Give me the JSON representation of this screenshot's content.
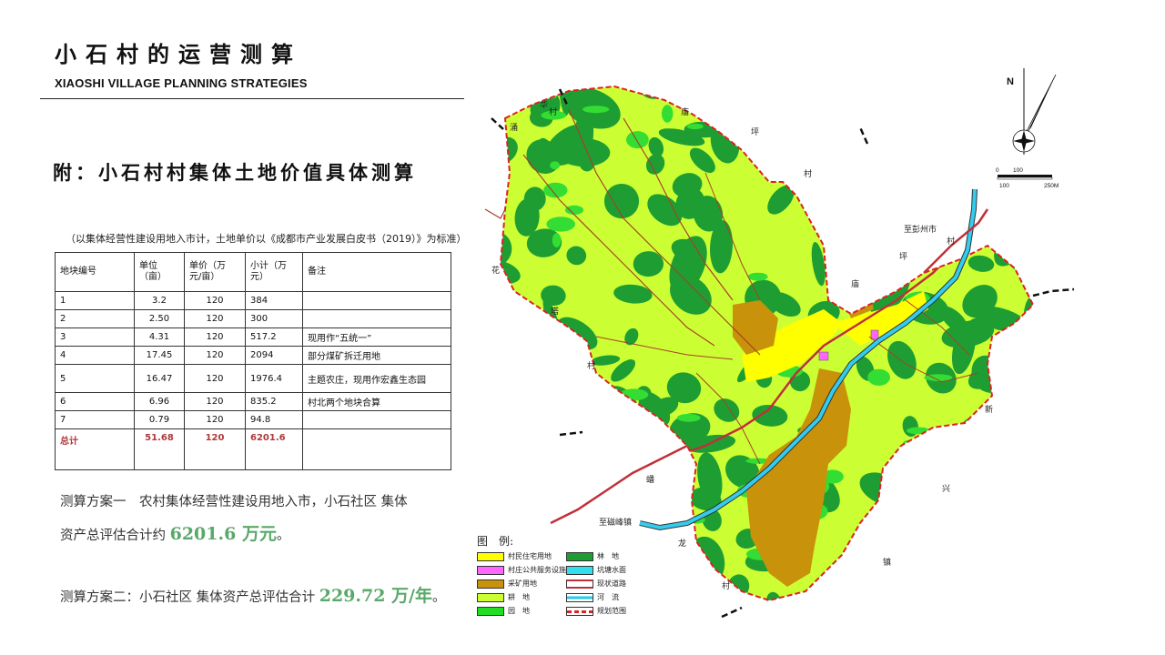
{
  "header": {
    "title_cn": "小石村的运营测算",
    "title_en": "XIAOSHI VILLAGE PLANNING STRATEGIES"
  },
  "section_title": "附：小石村村集体土地价值具体测算",
  "table_note": "（以集体经营性建设用地入市计，土地单价以《成都市产业发展白皮书（2019）》为标准）",
  "table": {
    "headers": [
      "地块编号",
      "单位\n（亩）",
      "单价（万元/亩）",
      "小计（万元）",
      "备注"
    ],
    "rows": [
      [
        "1",
        "3.2",
        "120",
        "384",
        ""
      ],
      [
        "2",
        "2.50",
        "120",
        "300",
        ""
      ],
      [
        "3",
        "4.31",
        "120",
        "517.2",
        "现用作“五统一”"
      ],
      [
        "4",
        "17.45",
        "120",
        "2094",
        "部分煤矿拆迁用地"
      ],
      [
        "5",
        "16.47",
        "120",
        "1976.4",
        "主题农庄，现用作宏鑫生态园"
      ],
      [
        "6",
        "6.96",
        "120",
        "835.2",
        "村北两个地块合算"
      ],
      [
        "7",
        "0.79",
        "120",
        "94.8",
        ""
      ]
    ],
    "total": [
      "总计",
      "51.68",
      "120",
      "6201.6",
      ""
    ]
  },
  "calc1": {
    "line1": "测算方案一　农村集体经营性建设用地入市，小石社区 集体",
    "line2_prefix": "资产总评估合计约",
    "line2_value": "6201.6 万元",
    "line2_suffix": "。"
  },
  "calc2": {
    "prefix": "测算方案二：小石社区 集体资产总评估合计",
    "value": "229.72 万/年",
    "suffix": "。"
  },
  "map": {
    "labels": {
      "north": "N",
      "scale_0": "0",
      "scale_100": "100",
      "scale_100b": "100",
      "scale_250": "250M",
      "to_pengzhou": "至彭州市",
      "to_cifeng": "至磁峰镇",
      "village_names": [
        "涌",
        "华",
        "村",
        "庙",
        "坪",
        "村",
        "花",
        "塔",
        "村",
        "村",
        "坪",
        "庙",
        "新",
        "兴",
        "镇",
        "蟠",
        "龙",
        "村"
      ]
    },
    "legend_title": "图　例:",
    "legend": [
      {
        "label": "村民住宅用地",
        "color": "#ffff00"
      },
      {
        "label": "林　地",
        "color": "#1e9e32"
      },
      {
        "label": "村庄公共服务设施用地",
        "color": "#ff66ff"
      },
      {
        "label": "坑塘水面",
        "color": "#33ddee"
      },
      {
        "label": "采矿用地",
        "color": "#c8920a"
      },
      {
        "label": "现状道路",
        "color": "#c0303a"
      },
      {
        "label": "耕　地",
        "color": "#ccff33"
      },
      {
        "label": "河　流",
        "color": "#22ccee"
      },
      {
        "label": "园　地",
        "color": "#22dd22"
      },
      {
        "label": "规划范围",
        "color": "#dd2222"
      }
    ]
  }
}
